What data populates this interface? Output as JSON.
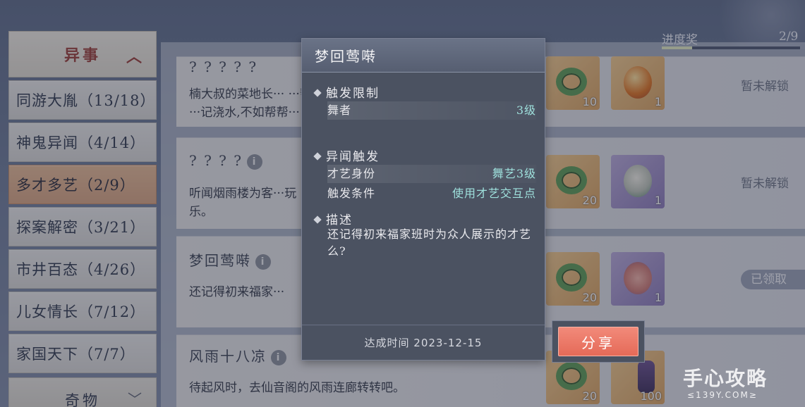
{
  "sidebar": {
    "header": "异事",
    "items": [
      {
        "label": "同游大胤（13/18）"
      },
      {
        "label": "神鬼异闻（4/14）"
      },
      {
        "label": "多才多艺（2/9）"
      },
      {
        "label": "探案解密（3/21）"
      },
      {
        "label": "市井百态（4/26）"
      },
      {
        "label": "儿女情长（7/12）"
      },
      {
        "label": "家国天下（7/7）"
      }
    ],
    "active_index": 2,
    "footer": "奇物"
  },
  "progress": {
    "label": "进度奖",
    "value": "2/9",
    "fraction": 0.22
  },
  "entries": [
    {
      "title": "? ? ? ? ?",
      "desc": "楠大叔的菜地长··· ···帮帮···记浇水,不如帮帮···",
      "status": "暂未解锁"
    },
    {
      "title": "? ? ? ?",
      "desc": "听闻烟雨楼为客···玩乐。",
      "status": "暂未解锁"
    },
    {
      "title": "梦回莺啭",
      "desc": "还记得初来福家···",
      "status": "已领取"
    },
    {
      "title": "风雨十八凉",
      "desc": "待起风时，去仙音阁的风雨连廊转转吧。",
      "status": ""
    }
  ],
  "rewards": [
    {
      "qty": "10"
    },
    {
      "qty": "1"
    },
    {
      "qty": "20"
    },
    {
      "qty": "1"
    },
    {
      "qty": "20"
    },
    {
      "qty": "1"
    },
    {
      "qty": "20"
    },
    {
      "qty": "100"
    }
  ],
  "modal": {
    "title": "梦回莺啭",
    "section1": "触发限制",
    "row1_label": "舞者",
    "row1_value": "3级",
    "section2": "异闻触发",
    "row2_label": "才艺身份",
    "row2_value": "舞艺3级",
    "row3_label": "触发条件",
    "row3_value": "使用才艺交互点",
    "section3": "描述",
    "description": "还记得初来福家班时为众人展示的才艺么?",
    "footer": "达成时间 2023-12-15"
  },
  "share_label": "分享",
  "watermark": {
    "line1": "手心攻略",
    "line2": "≤139Y.COM≥"
  },
  "colors": {
    "accent_red": "#9a3b34",
    "active_tab": "#d9a47f",
    "share": "#e56a58",
    "value_teal": "#9ee0dc"
  }
}
